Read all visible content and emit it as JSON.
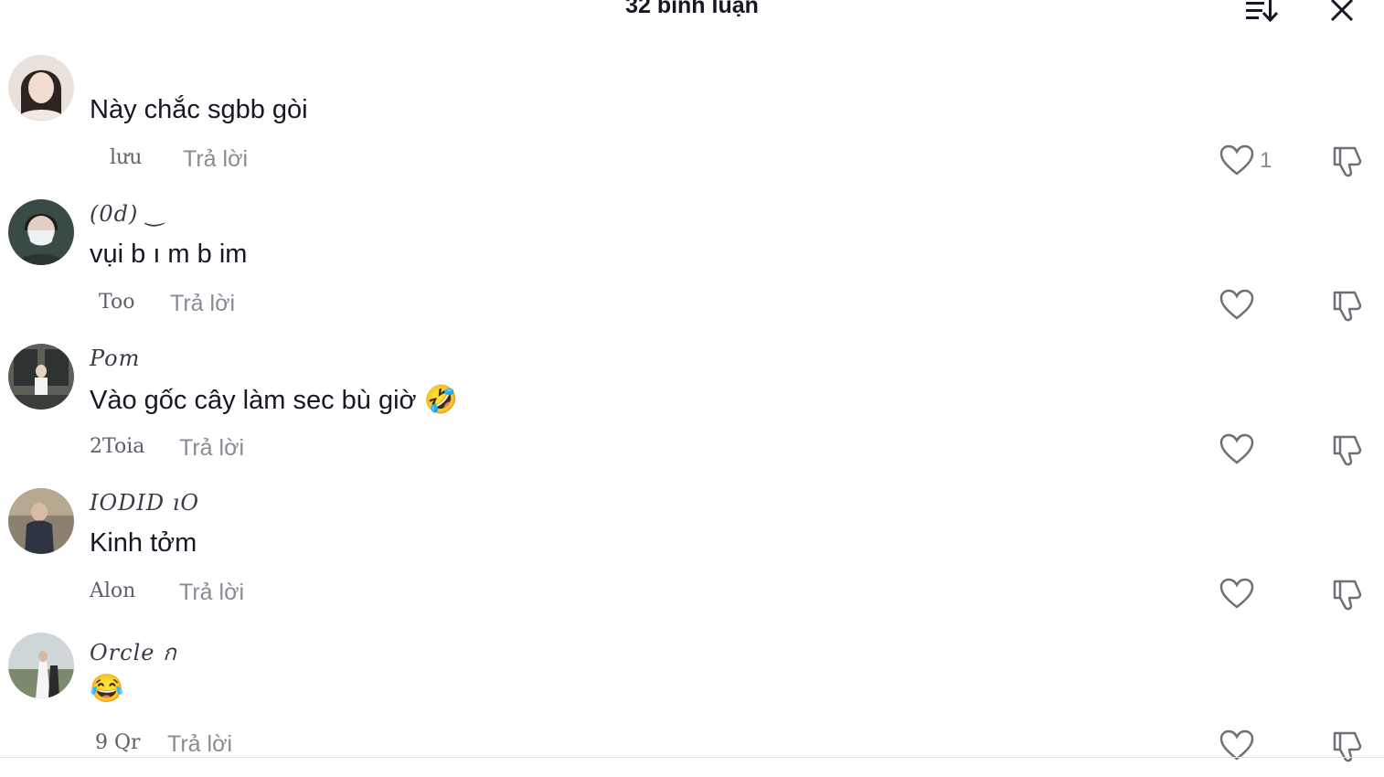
{
  "header": {
    "title": "32 bình luận"
  },
  "icons": {
    "sort": "sort-icon",
    "close": "close-icon",
    "like": "heart-icon",
    "dislike": "thumbs-down-icon"
  },
  "colors": {
    "text": "#161823",
    "muted": "#8a8a94"
  },
  "comments": [
    {
      "username": "",
      "text": "Này chắc sgbb gòi",
      "time": "lưu",
      "reply": "Trả lời",
      "likes": "1"
    },
    {
      "username": "(0d) ‿",
      "text": "vụi b ı m b im",
      "time": "Too",
      "reply": "Trả lời",
      "likes": ""
    },
    {
      "username": "Pom",
      "text": "Vào gốc cây làm sec bù giờ",
      "emoji": "🤣",
      "time": "2Toia",
      "reply": "Trả lời",
      "likes": ""
    },
    {
      "username": "IODID  ıO",
      "text": "Kinh tởm",
      "time": "Alon",
      "reply": "Trả lời",
      "likes": ""
    },
    {
      "username": "Orcle   ก",
      "text": "",
      "emoji": "😂",
      "time": "9 Qr",
      "reply": "Trả lời",
      "likes": ""
    }
  ]
}
